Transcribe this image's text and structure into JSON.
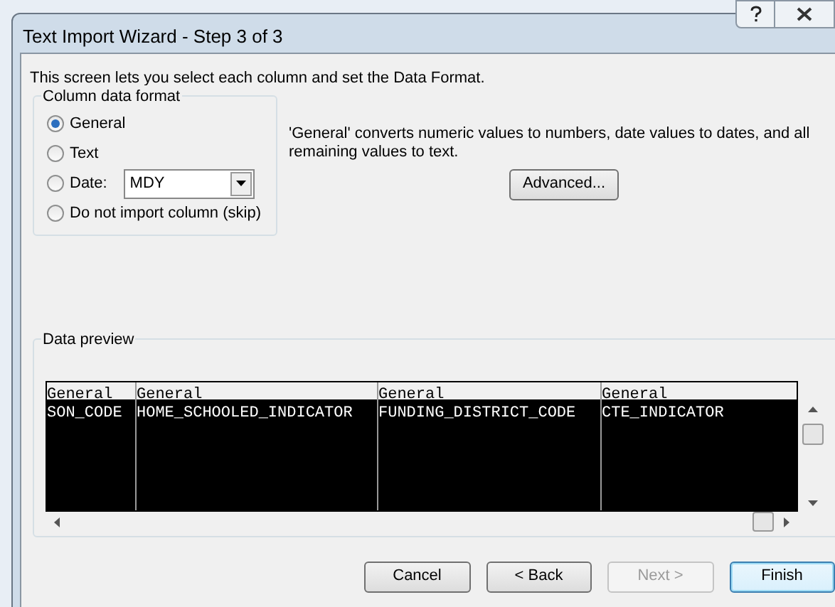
{
  "window": {
    "title": "Text Import Wizard - Step 3 of 3"
  },
  "intro": "This screen lets you select each column and set the Data Format.",
  "column_data_format": {
    "legend": "Column data format",
    "options": [
      {
        "label": "General",
        "selected": true,
        "kind": "plain"
      },
      {
        "label": "Text",
        "selected": false,
        "kind": "plain"
      },
      {
        "label": "Date:",
        "selected": false,
        "kind": "date",
        "value": "MDY"
      },
      {
        "label": "Do not import column (skip)",
        "selected": false,
        "kind": "plain"
      }
    ]
  },
  "description": "'General' converts numeric values to numbers, date values to dates, and all remaining values to text.",
  "advanced_button": "Advanced...",
  "data_preview": {
    "legend": "Data preview",
    "columns": [
      {
        "header": "General",
        "cell": "SON_CODE"
      },
      {
        "header": "General",
        "cell": "HOME_SCHOOLED_INDICATOR"
      },
      {
        "header": "General",
        "cell": "FUNDING_DISTRICT_CODE"
      },
      {
        "header": "General",
        "cell": "CTE_INDICATOR"
      }
    ]
  },
  "buttons": [
    {
      "label": "Cancel",
      "disabled": false,
      "default": false
    },
    {
      "label": "< Back",
      "disabled": false,
      "default": false
    },
    {
      "label": "Next >",
      "disabled": true,
      "default": false
    },
    {
      "label": "Finish",
      "disabled": false,
      "default": true
    }
  ]
}
